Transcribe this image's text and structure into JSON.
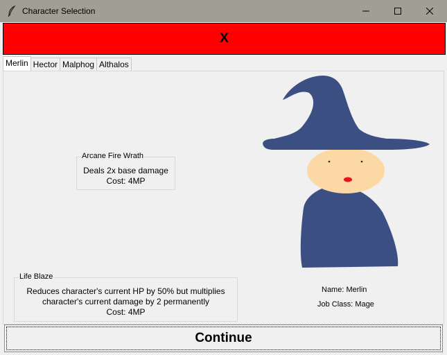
{
  "window": {
    "title": "Character Selection",
    "icon": "feather-icon",
    "controls": [
      "minimize-icon",
      "maximize-icon",
      "close-icon"
    ]
  },
  "close_bar": {
    "label": "X",
    "color": "#ff0000"
  },
  "tabs": [
    {
      "label": "Merlin",
      "active": true
    },
    {
      "label": "Hector",
      "active": false
    },
    {
      "label": "Malphog",
      "active": false
    },
    {
      "label": "Althalos",
      "active": false
    }
  ],
  "abilities": {
    "arcane": {
      "title": "Arcane Fire Wrath",
      "line1": "Deals 2x base damage",
      "line2": "Cost: 4MP"
    },
    "lifeblaze": {
      "title": "Life Blaze",
      "line1": "Reduces character's current HP by 50% but multiplies",
      "line2": "character's current damage by 2 permanently",
      "line3": "Cost: 4MP"
    }
  },
  "character": {
    "name": "Name: Merlin",
    "job": "Job Class: Mage",
    "robe_color": "#3c4f83",
    "face_color": "#fcd9a4"
  },
  "continue_label": "Continue"
}
